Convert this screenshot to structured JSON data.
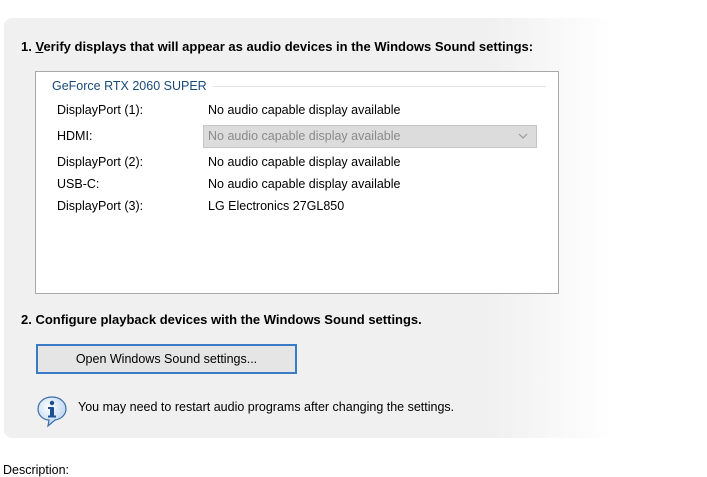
{
  "step1": {
    "number": "1.",
    "underlined_letter": "V",
    "rest": "erify displays that will appear as audio devices in the Windows Sound settings:"
  },
  "gpu": {
    "title": "GeForce RTX 2060 SUPER",
    "ports": [
      {
        "label": "DisplayPort (1):",
        "value": "No audio capable display available"
      },
      {
        "label": "HDMI:",
        "value": "No audio capable display available",
        "disabled_select": true
      },
      {
        "label": "DisplayPort (2):",
        "value": "No audio capable display available"
      },
      {
        "label": "USB-C:",
        "value": "No audio capable display available"
      },
      {
        "label": "DisplayPort (3):",
        "value": "LG Electronics 27GL850"
      }
    ]
  },
  "step2": {
    "text": "2. Configure playback devices with the Windows Sound settings."
  },
  "sound_button": {
    "label": "Open Windows Sound settings..."
  },
  "info": {
    "icon": "info-icon",
    "text": "You may need to restart audio programs after changing the settings."
  },
  "description": {
    "label": "Description:"
  },
  "colors": {
    "panel_bg": "#f0f0f0",
    "gpu_title": "#1a4a7a",
    "button_border": "#3a7bc8"
  }
}
